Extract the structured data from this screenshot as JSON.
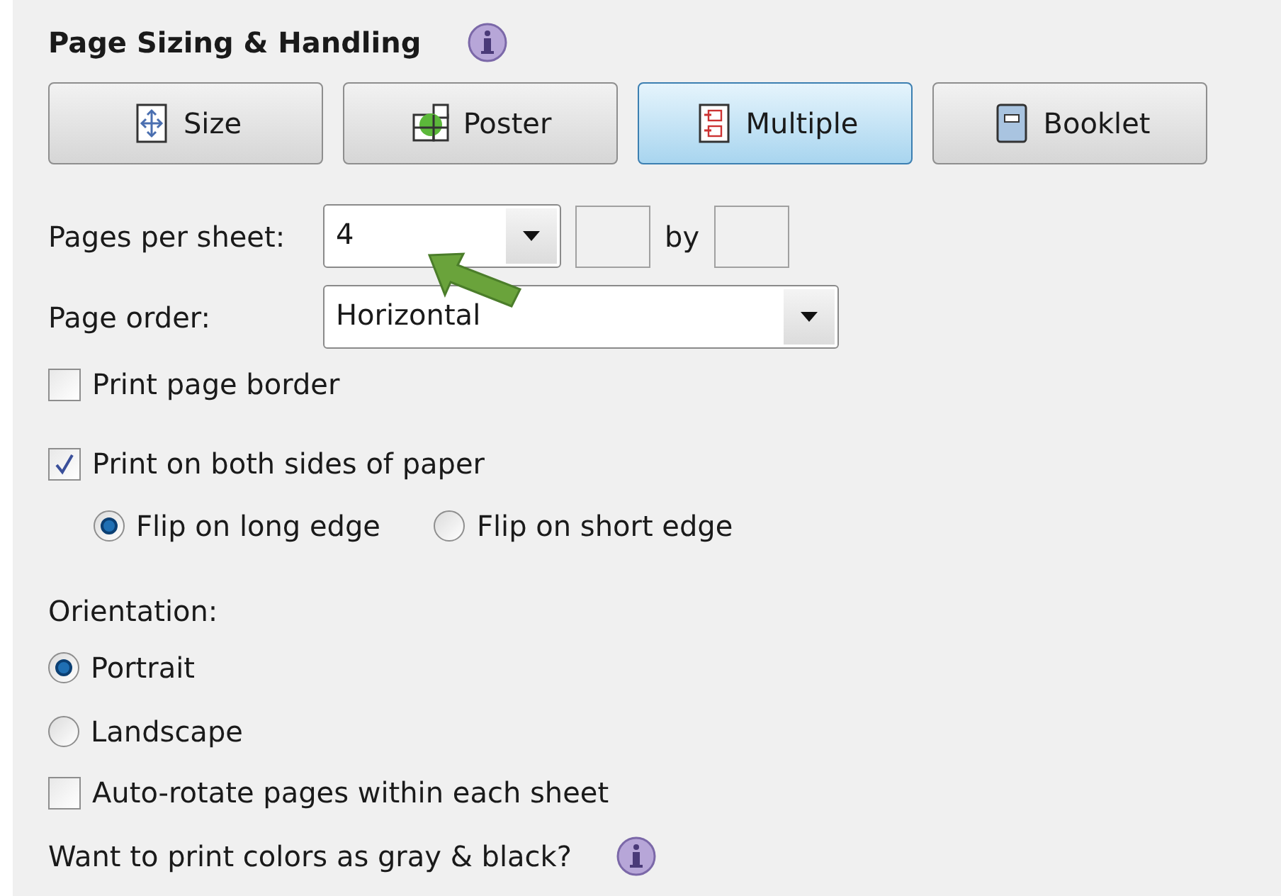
{
  "section": {
    "title": "Page Sizing & Handling"
  },
  "modes": [
    {
      "kind": "size",
      "label": "Size",
      "selected": false
    },
    {
      "kind": "poster",
      "label": "Poster",
      "selected": false
    },
    {
      "kind": "multiple",
      "label": "Multiple",
      "selected": true
    },
    {
      "kind": "booklet",
      "label": "Booklet",
      "selected": false
    }
  ],
  "pages_per_sheet": {
    "label": "Pages per sheet:",
    "value": "4",
    "by_label": "by"
  },
  "page_order": {
    "label": "Page order:",
    "value": "Horizontal"
  },
  "print_page_border": {
    "label": "Print page border",
    "checked": false
  },
  "both_sides": {
    "label": "Print on both sides of paper",
    "checked": true
  },
  "flip": [
    {
      "label": "Flip on long edge",
      "selected": true
    },
    {
      "label": "Flip on short edge",
      "selected": false
    }
  ],
  "orientation": {
    "label": "Orientation:",
    "options": [
      {
        "label": "Portrait",
        "selected": true
      },
      {
        "label": "Landscape",
        "selected": false
      }
    ]
  },
  "auto_rotate": {
    "label": "Auto-rotate pages within each sheet",
    "checked": false
  },
  "gray_print": {
    "label": "Want to print colors as gray & black?"
  }
}
